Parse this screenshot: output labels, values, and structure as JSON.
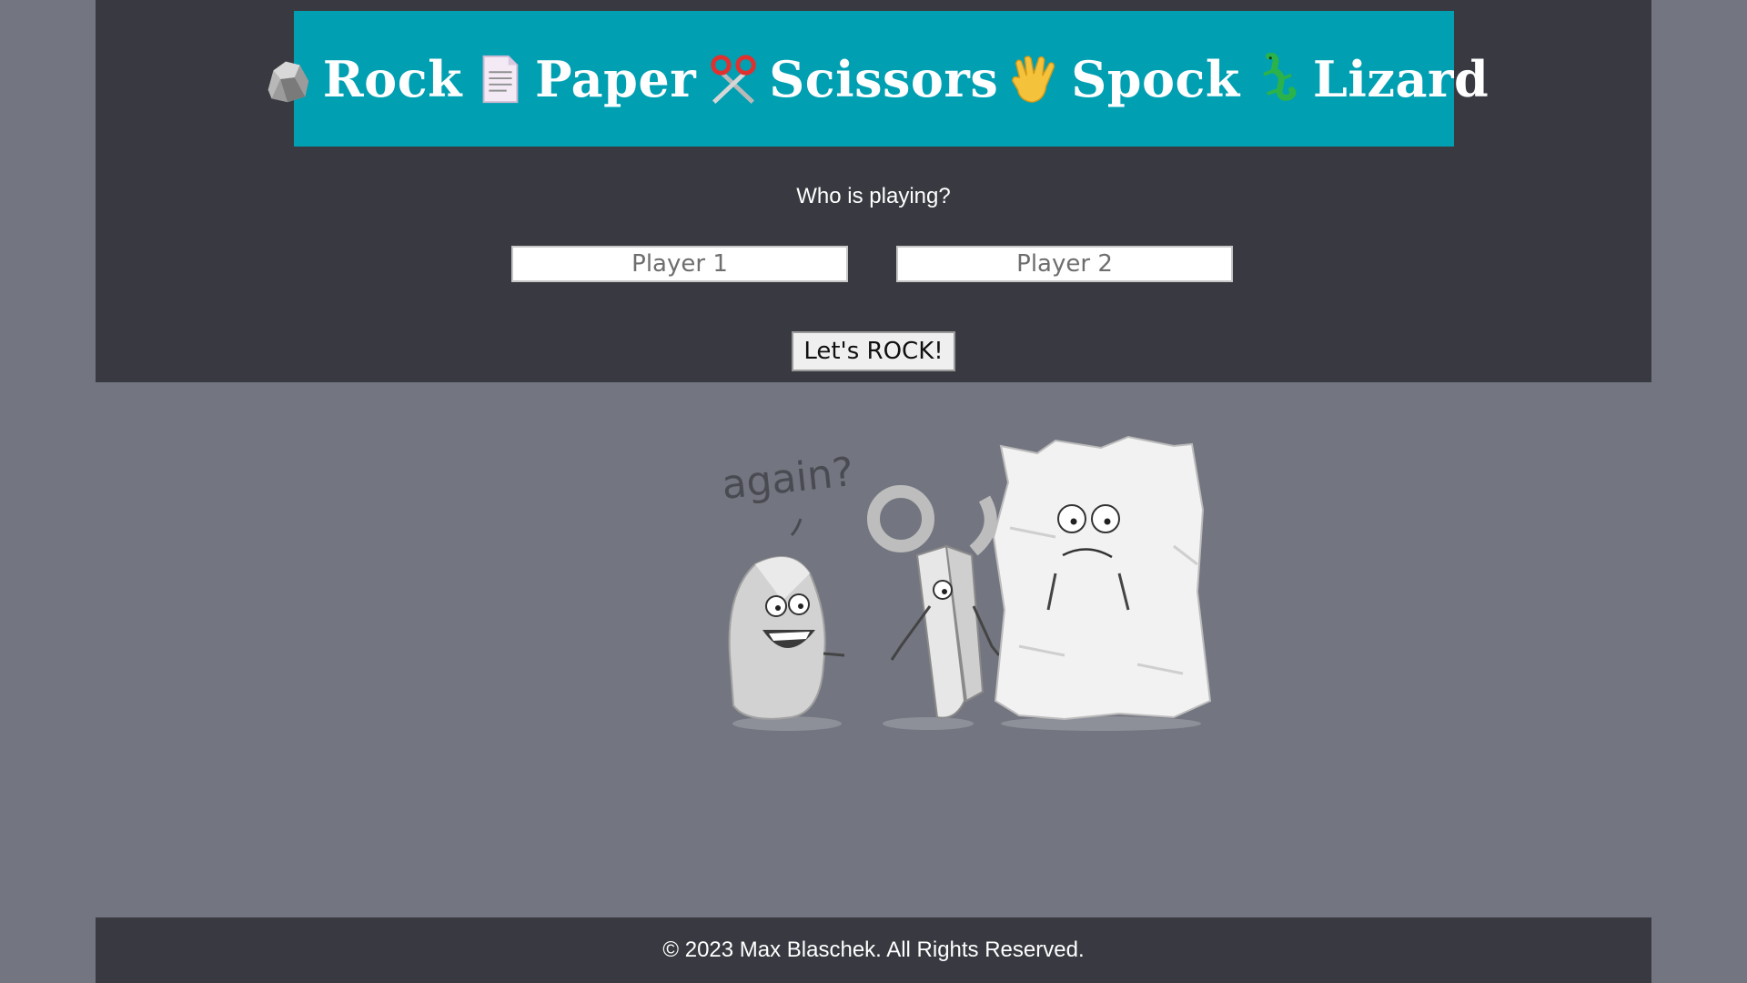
{
  "banner": {
    "items": [
      {
        "label": "Rock",
        "icon": "rock-icon"
      },
      {
        "label": "Paper",
        "icon": "paper-icon"
      },
      {
        "label": "Scissors",
        "icon": "scissors-icon"
      },
      {
        "label": "Spock",
        "icon": "spock-hand-icon"
      },
      {
        "label": "Lizard",
        "icon": "lizard-icon"
      }
    ],
    "background_color": "#009fb2"
  },
  "setup": {
    "prompt": "Who is playing?",
    "player1_placeholder": "Player 1",
    "player2_placeholder": "Player 2",
    "start_label": "Let's ROCK!"
  },
  "illustration": {
    "caption": "again?"
  },
  "footer": {
    "text": "© 2023 Max Blaschek. All Rights Reserved."
  },
  "colors": {
    "page_background": "#737680",
    "panel_background": "#393a41",
    "banner": "#009fb2"
  }
}
